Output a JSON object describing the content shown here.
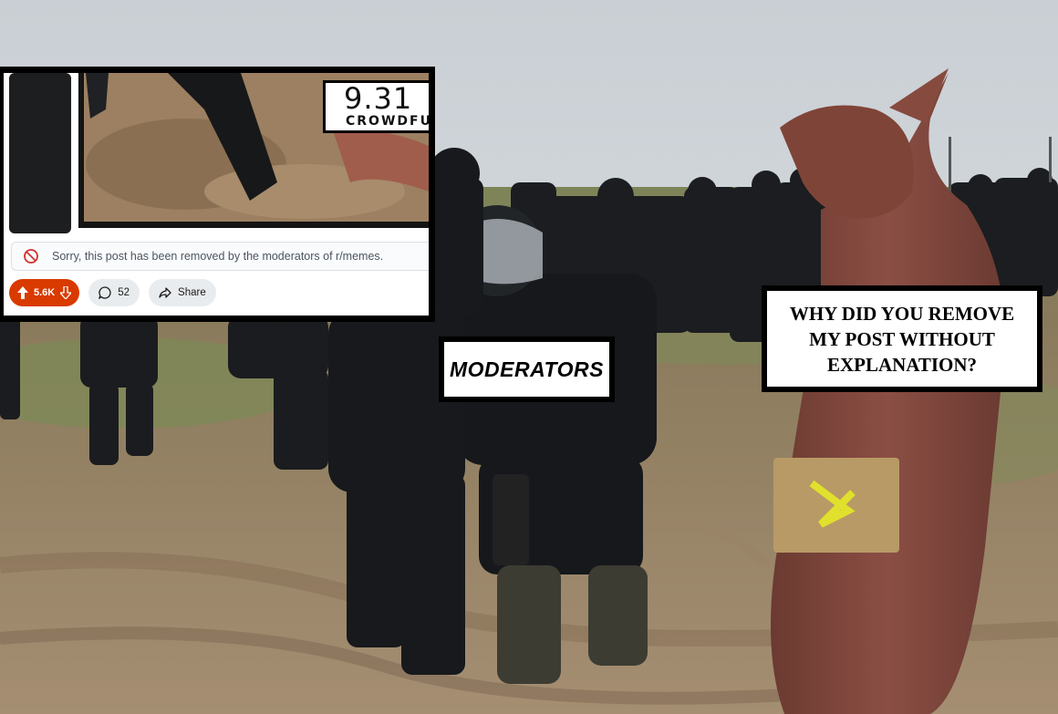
{
  "inset": {
    "counter_number": "9.31",
    "counter_label": "CROWDFU",
    "removed_notice": "Sorry, this post has been removed by the moderators of r/memes.",
    "votes": "5.6K",
    "comments": "52",
    "share_label": "Share",
    "vote_color": "#d93a00"
  },
  "captions": {
    "moderators": "MODERATORS",
    "question_lines": [
      "WHY DID YOU REMOVE",
      "MY POST WITHOUT",
      "EXPLANATION?"
    ]
  },
  "icons": [
    "blocked-icon",
    "upvote-icon",
    "downvote-icon",
    "comment-icon",
    "share-icon"
  ]
}
